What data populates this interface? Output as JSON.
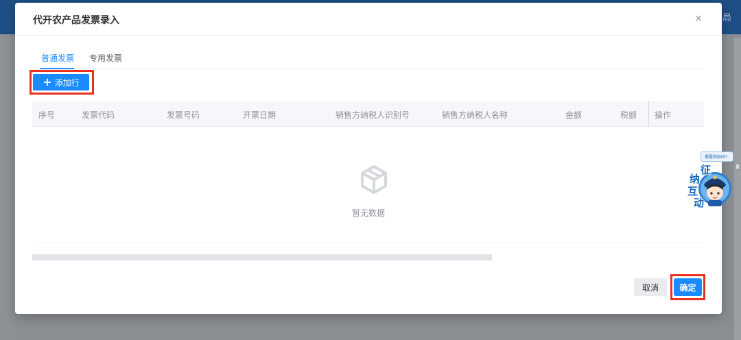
{
  "background": {
    "header_text": "局"
  },
  "dialog": {
    "title": "代开农产品发票录入",
    "close_glyph": "×"
  },
  "tabs": [
    {
      "label": "普通发票",
      "active": true
    },
    {
      "label": "专用发票",
      "active": false
    }
  ],
  "toolbar": {
    "add_row_label": "添加行",
    "plus_glyph": "+"
  },
  "table": {
    "columns": [
      "序号",
      "发票代码",
      "发票号码",
      "开票日期",
      "销售方纳税人识别号",
      "销售方纳税人名称",
      "金额",
      "税额",
      "操作"
    ],
    "rows": [],
    "empty_text": "暂无数据"
  },
  "footer": {
    "cancel_label": "取消",
    "confirm_label": "确定"
  },
  "assistant": {
    "bubble_text": "需要帮助吗？",
    "chars": [
      "征",
      "纳",
      "互",
      "动"
    ]
  },
  "colors": {
    "primary": "#1a8cff",
    "highlight": "#e8321e",
    "header": "#1f4e86"
  }
}
